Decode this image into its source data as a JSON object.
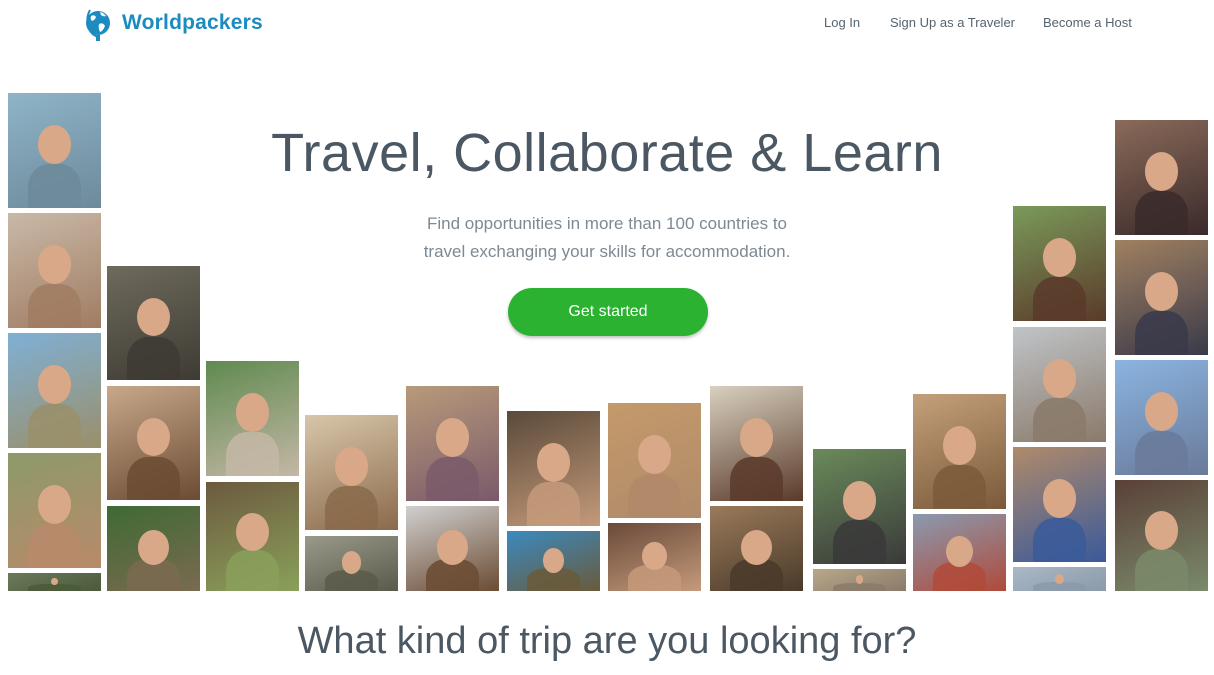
{
  "header": {
    "brand": "Worldpackers",
    "nav": {
      "login": "Log In",
      "signup_traveler": "Sign Up as a Traveler",
      "become_host": "Become a Host"
    }
  },
  "hero": {
    "title": "Travel, Collaborate & Learn",
    "subtitle_line1": "Find opportunities in more than 100 countries to",
    "subtitle_line2": "travel exchanging your skills for accommodation.",
    "cta_label": "Get started"
  },
  "section": {
    "title": "What kind of trip are you looking for?"
  },
  "colors": {
    "brand": "#1b8bc0",
    "cta": "#2bb230",
    "text": "#4b5863"
  },
  "icons": {
    "logo": "globe-icon"
  },
  "photos": [
    "photo-1",
    "photo-2",
    "photo-3",
    "photo-4",
    "photo-5",
    "photo-6",
    "photo-7",
    "photo-8",
    "photo-9",
    "photo-10",
    "photo-11",
    "photo-12",
    "photo-13",
    "photo-14",
    "photo-15",
    "photo-16",
    "photo-17",
    "photo-18",
    "photo-19",
    "photo-20",
    "photo-21",
    "photo-22",
    "photo-23",
    "photo-24",
    "photo-25",
    "photo-26",
    "photo-27",
    "photo-28",
    "photo-29",
    "photo-30",
    "photo-31",
    "photo-32",
    "photo-33",
    "photo-34",
    "photo-35",
    "photo-36",
    "photo-37",
    "photo-38"
  ]
}
